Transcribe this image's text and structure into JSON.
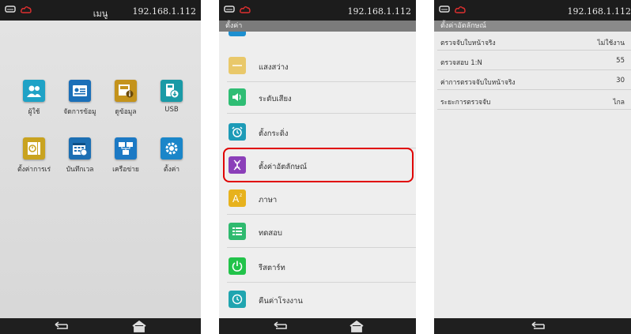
{
  "status": {
    "ip": "192.168.1.112"
  },
  "screen1": {
    "title": "เมนู",
    "items": [
      {
        "label": "ผู้ใช้",
        "icon": "users-icon",
        "color": "#1fa2c6"
      },
      {
        "label": "จัดการข้อมู",
        "icon": "id-card-icon",
        "color": "#1b6fb8"
      },
      {
        "label": "ดูข้อมูล",
        "icon": "info-icon",
        "color": "#c4931c"
      },
      {
        "label": "USB",
        "icon": "usb-icon",
        "color": "#1a9aa6"
      },
      {
        "label": "ตั้งค่าการเร่",
        "icon": "rules-icon",
        "color": "#c9a320"
      },
      {
        "label": "บันทึกเวล",
        "icon": "calendar-icon",
        "color": "#1c6fb3"
      },
      {
        "label": "เครือข่าย",
        "icon": "network-icon",
        "color": "#1c79c4"
      },
      {
        "label": "ตั้งค่า",
        "icon": "gear-icon",
        "color": "#1a86c9"
      }
    ]
  },
  "screen2": {
    "title": "ตั้งค่า",
    "items": [
      {
        "label": "แสงสว่าง",
        "icon": "brightness-icon",
        "color": "#e9c86a"
      },
      {
        "label": "ระดับเสียง",
        "icon": "volume-icon",
        "color": "#2fbd74"
      },
      {
        "label": "ตั้งกระดิ่ง",
        "icon": "alarm-icon",
        "color": "#1d9bb7"
      },
      {
        "label": "ตั้งค่าอัตลักษณ์",
        "icon": "dna-icon",
        "color": "#8b3fb9"
      },
      {
        "label": "ภาษา",
        "icon": "language-icon",
        "color": "#e7b21d"
      },
      {
        "label": "ทดสอบ",
        "icon": "checklist-icon",
        "color": "#2fba6f"
      },
      {
        "label": "รีสตาร์ท",
        "icon": "power-icon",
        "color": "#22c34a"
      },
      {
        "label": "คืนค่าโรงงาน",
        "icon": "restore-icon",
        "color": "#20a5b0"
      }
    ]
  },
  "screen3": {
    "title": "ตั้งค่าอัตลักษณ์",
    "rows": [
      {
        "label": "ตรวจจับใบหน้าจริง",
        "value": "ไม่ใช้งาน"
      },
      {
        "label": "ตรวจสอบ 1:N",
        "value": "55"
      },
      {
        "label": "ค่าการตรวจจับใบหน้าจริง",
        "value": "30"
      },
      {
        "label": "ระยะการตรวจจับ",
        "value": "ไกล"
      }
    ]
  },
  "colors": {
    "highlight": "#e00000",
    "statusbar": "#1c1c1c"
  }
}
